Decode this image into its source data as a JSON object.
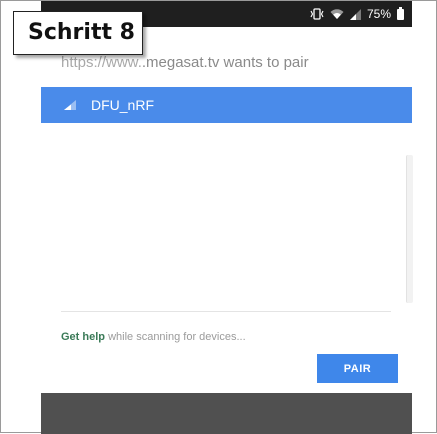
{
  "step_label": "Schritt 8",
  "status_bar": {
    "battery_percent": "75%",
    "icons": [
      "vibrate-icon",
      "wifi-icon",
      "signal-icon",
      "battery-icon"
    ]
  },
  "dialog": {
    "title_url_fragment": "https://www.",
    "title_rest": ".megasat.tv wants to pair"
  },
  "devices": [
    {
      "name": "DFU_nRF",
      "selected": true
    }
  ],
  "help": {
    "link_label": "Get help",
    "rest_text": " while scanning for devices..."
  },
  "pair_button_label": "PAIR",
  "colors": {
    "accent": "#4a8bea",
    "pair_button": "#3f87ea",
    "help_link": "#3a7a57",
    "status_bar": "#1f1f1f",
    "nav_bar": "#505050"
  }
}
